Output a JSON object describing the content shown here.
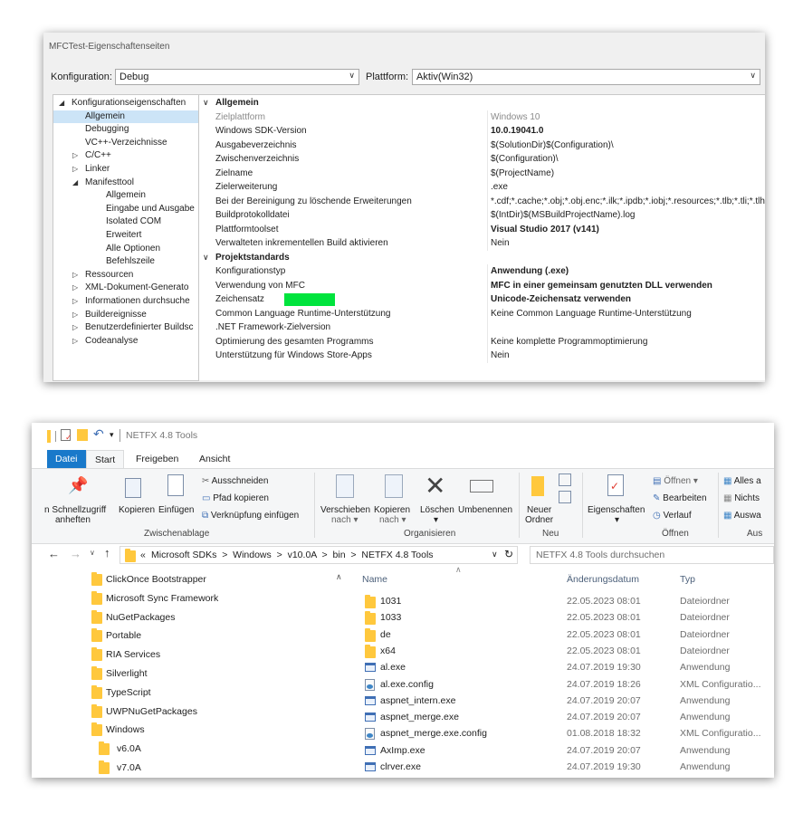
{
  "prop": {
    "title": "MFCTest-Eigenschaftenseiten",
    "config_label": "Konfiguration:",
    "config_value": "Debug",
    "platform_label": "Plattform:",
    "platform_value": "Aktiv(Win32)",
    "tree": [
      {
        "label": "Konfigurationseigenschaften",
        "level": 0,
        "exp": "◢"
      },
      {
        "label": "Allgemein",
        "level": 1,
        "exp": "",
        "selected": true
      },
      {
        "label": "Debugging",
        "level": 1,
        "exp": ""
      },
      {
        "label": "VC++-Verzeichnisse",
        "level": 1,
        "exp": ""
      },
      {
        "label": "C/C++",
        "level": 1,
        "exp": "▷"
      },
      {
        "label": "Linker",
        "level": 1,
        "exp": "▷"
      },
      {
        "label": "Manifesttool",
        "level": 1,
        "exp": "◢"
      },
      {
        "label": "Allgemein",
        "level": 2,
        "exp": ""
      },
      {
        "label": "Eingabe und Ausgabe",
        "level": 2,
        "exp": ""
      },
      {
        "label": "Isolated COM",
        "level": 2,
        "exp": ""
      },
      {
        "label": "Erweitert",
        "level": 2,
        "exp": ""
      },
      {
        "label": "Alle Optionen",
        "level": 2,
        "exp": ""
      },
      {
        "label": "Befehlszeile",
        "level": 2,
        "exp": ""
      },
      {
        "label": "Ressourcen",
        "level": 1,
        "exp": "▷"
      },
      {
        "label": "XML-Dokument-Generato",
        "level": 1,
        "exp": "▷"
      },
      {
        "label": "Informationen durchsuche",
        "level": 1,
        "exp": "▷"
      },
      {
        "label": "Buildereignisse",
        "level": 1,
        "exp": "▷"
      },
      {
        "label": "Benutzerdefinierter Buildsc",
        "level": 1,
        "exp": "▷"
      },
      {
        "label": "Codeanalyse",
        "level": 1,
        "exp": "▷"
      }
    ],
    "grid": [
      {
        "cat": true,
        "name": "Allgemein",
        "chev": "∨"
      },
      {
        "name": "Zielplattform",
        "value": "Windows 10",
        "dim": true
      },
      {
        "name": "Windows SDK-Version",
        "value": "10.0.19041.0",
        "bold": true
      },
      {
        "name": "Ausgabeverzeichnis",
        "value": "$(SolutionDir)$(Configuration)\\"
      },
      {
        "name": "Zwischenverzeichnis",
        "value": "$(Configuration)\\"
      },
      {
        "name": "Zielname",
        "value": "$(ProjectName)"
      },
      {
        "name": "Zielerweiterung",
        "value": ".exe"
      },
      {
        "name": "Bei der Bereinigung zu löschende Erweiterungen",
        "value": "*.cdf;*.cache;*.obj;*.obj.enc;*.ilk;*.ipdb;*.iobj;*.resources;*.tlb;*.tli;*.tlh;*."
      },
      {
        "name": "Buildprotokolldatei",
        "value": "$(IntDir)$(MSBuildProjectName).log"
      },
      {
        "name": "Plattformtoolset",
        "value": "Visual Studio 2017 (v141)",
        "bold": true
      },
      {
        "name": "Verwalteten inkrementellen Build aktivieren",
        "value": "Nein"
      },
      {
        "cat": true,
        "name": "Projektstandards",
        "chev": "∨"
      },
      {
        "name": "Konfigurationstyp",
        "value": "Anwendung (.exe)",
        "bold": true
      },
      {
        "name": "Verwendung von MFC",
        "value": "MFC in einer gemeinsam genutzten DLL verwenden",
        "bold": true
      },
      {
        "name": "Zeichensatz",
        "value": "Unicode-Zeichensatz verwenden",
        "bold": true,
        "patch": true
      },
      {
        "name": "Common Language Runtime-Unterstützung",
        "value": "Keine Common Language Runtime-Unterstützung"
      },
      {
        "name": ".NET Framework-Zielversion",
        "value": ""
      },
      {
        "name": "Optimierung des gesamten Programms",
        "value": "Keine komplette Programmoptimierung"
      },
      {
        "name": "Unterstützung für Windows Store-Apps",
        "value": "Nein"
      }
    ]
  },
  "explorer": {
    "title": "NETFX 4.8 Tools",
    "tabs": {
      "file": "Datei",
      "start": "Start",
      "share": "Freigeben",
      "view": "Ansicht"
    },
    "ribbon": {
      "pin": "n Schnellzugriff",
      "pin2": "anheften",
      "copy": "Kopieren",
      "paste": "Einfügen",
      "cut": "Ausschneiden",
      "copy_path": "Pfad kopieren",
      "paste_link": "Verknüpfung einfügen",
      "move": "Verschieben",
      "move2": "nach",
      "copyto": "Kopieren",
      "copyto2": "nach",
      "delete": "Löschen",
      "rename": "Umbenennen",
      "new_folder": "Neuer",
      "new_folder2": "Ordner",
      "properties": "Eigenschaften",
      "open": "Öffnen",
      "edit": "Bearbeiten",
      "history": "Verlauf",
      "select_all": "Alles a",
      "select_none": "Nichts",
      "invert": "Auswa",
      "grp_clipboard": "Zwischenablage",
      "grp_organize": "Organisieren",
      "grp_new": "Neu",
      "grp_open": "Öffnen",
      "grp_select": "Aus"
    },
    "crumbs": [
      "Microsoft SDKs",
      "Windows",
      "v10.0A",
      "bin",
      "NETFX 4.8 Tools"
    ],
    "search_placeholder": "NETFX 4.8 Tools durchsuchen",
    "nav": [
      {
        "label": "ClickOnce Bootstrapper",
        "indent": 0
      },
      {
        "label": "Microsoft Sync Framework",
        "indent": 0
      },
      {
        "label": "NuGetPackages",
        "indent": 0
      },
      {
        "label": "Portable",
        "indent": 0
      },
      {
        "label": "RIA Services",
        "indent": 0
      },
      {
        "label": "Silverlight",
        "indent": 0
      },
      {
        "label": "TypeScript",
        "indent": 0
      },
      {
        "label": "UWPNuGetPackages",
        "indent": 0
      },
      {
        "label": "Windows",
        "indent": 0
      },
      {
        "label": "v6.0A",
        "indent": 1
      },
      {
        "label": "v7.0A",
        "indent": 1
      }
    ],
    "headers": {
      "name": "Name",
      "date": "Änderungsdatum",
      "type": "Typ"
    },
    "files": [
      {
        "name": "1031",
        "date": "22.05.2023 08:01",
        "type": "Dateiordner",
        "icon": "folder"
      },
      {
        "name": "1033",
        "date": "22.05.2023 08:01",
        "type": "Dateiordner",
        "icon": "folder"
      },
      {
        "name": "de",
        "date": "22.05.2023 08:01",
        "type": "Dateiordner",
        "icon": "folder"
      },
      {
        "name": "x64",
        "date": "22.05.2023 08:01",
        "type": "Dateiordner",
        "icon": "folder"
      },
      {
        "name": "al.exe",
        "date": "24.07.2019 19:30",
        "type": "Anwendung",
        "icon": "exe"
      },
      {
        "name": "al.exe.config",
        "date": "24.07.2019 18:26",
        "type": "XML Configuratio...",
        "icon": "cfg"
      },
      {
        "name": "aspnet_intern.exe",
        "date": "24.07.2019 20:07",
        "type": "Anwendung",
        "icon": "exe"
      },
      {
        "name": "aspnet_merge.exe",
        "date": "24.07.2019 20:07",
        "type": "Anwendung",
        "icon": "exe"
      },
      {
        "name": "aspnet_merge.exe.config",
        "date": "01.08.2018 18:32",
        "type": "XML Configuratio...",
        "icon": "cfg"
      },
      {
        "name": "AxImp.exe",
        "date": "24.07.2019 20:07",
        "type": "Anwendung",
        "icon": "exe"
      },
      {
        "name": "clrver.exe",
        "date": "24.07.2019 19:30",
        "type": "Anwendung",
        "icon": "exe"
      }
    ]
  }
}
